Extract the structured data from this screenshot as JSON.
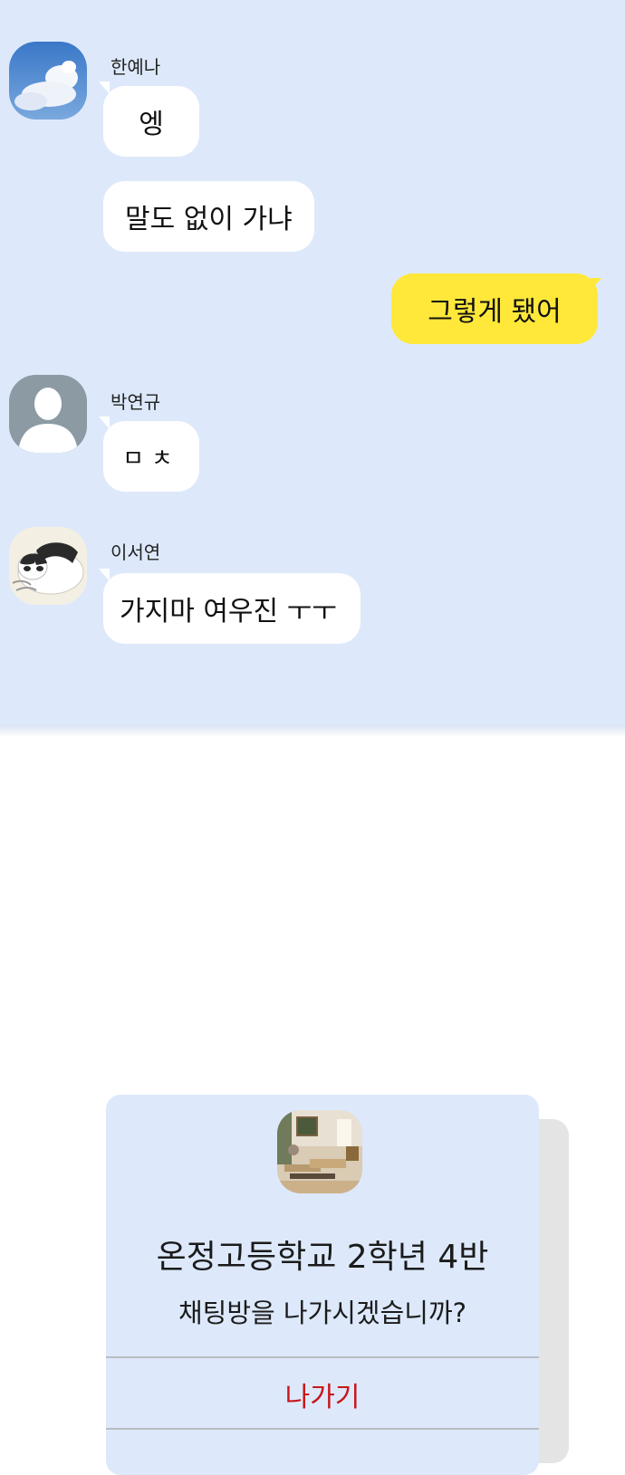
{
  "messages": [
    {
      "sender": "한예나",
      "bubbles": [
        "엥",
        "말도 없이 가냐"
      ]
    },
    {
      "sender": "me",
      "bubbles": [
        "그렇게 됐어"
      ]
    },
    {
      "sender": "박연규",
      "bubbles": [
        "ㅁㅊ"
      ]
    },
    {
      "sender": "이서연",
      "bubbles": [
        "가지마 여우진 ㅜㅜ"
      ]
    }
  ],
  "dialog": {
    "title": "온정고등학교 2학년 4반",
    "message": "채팅방을 나가시겠습니까?",
    "leave_label": "나가기"
  },
  "colors": {
    "chat_background": "#dde9fb",
    "my_bubble": "#ffe83a",
    "leave_text": "#c8171a"
  },
  "icons": {
    "avatar_1": "sky-cloud-avatar",
    "avatar_2": "default-person-avatar",
    "avatar_3": "cat-avatar",
    "room": "classroom-photo-icon"
  }
}
